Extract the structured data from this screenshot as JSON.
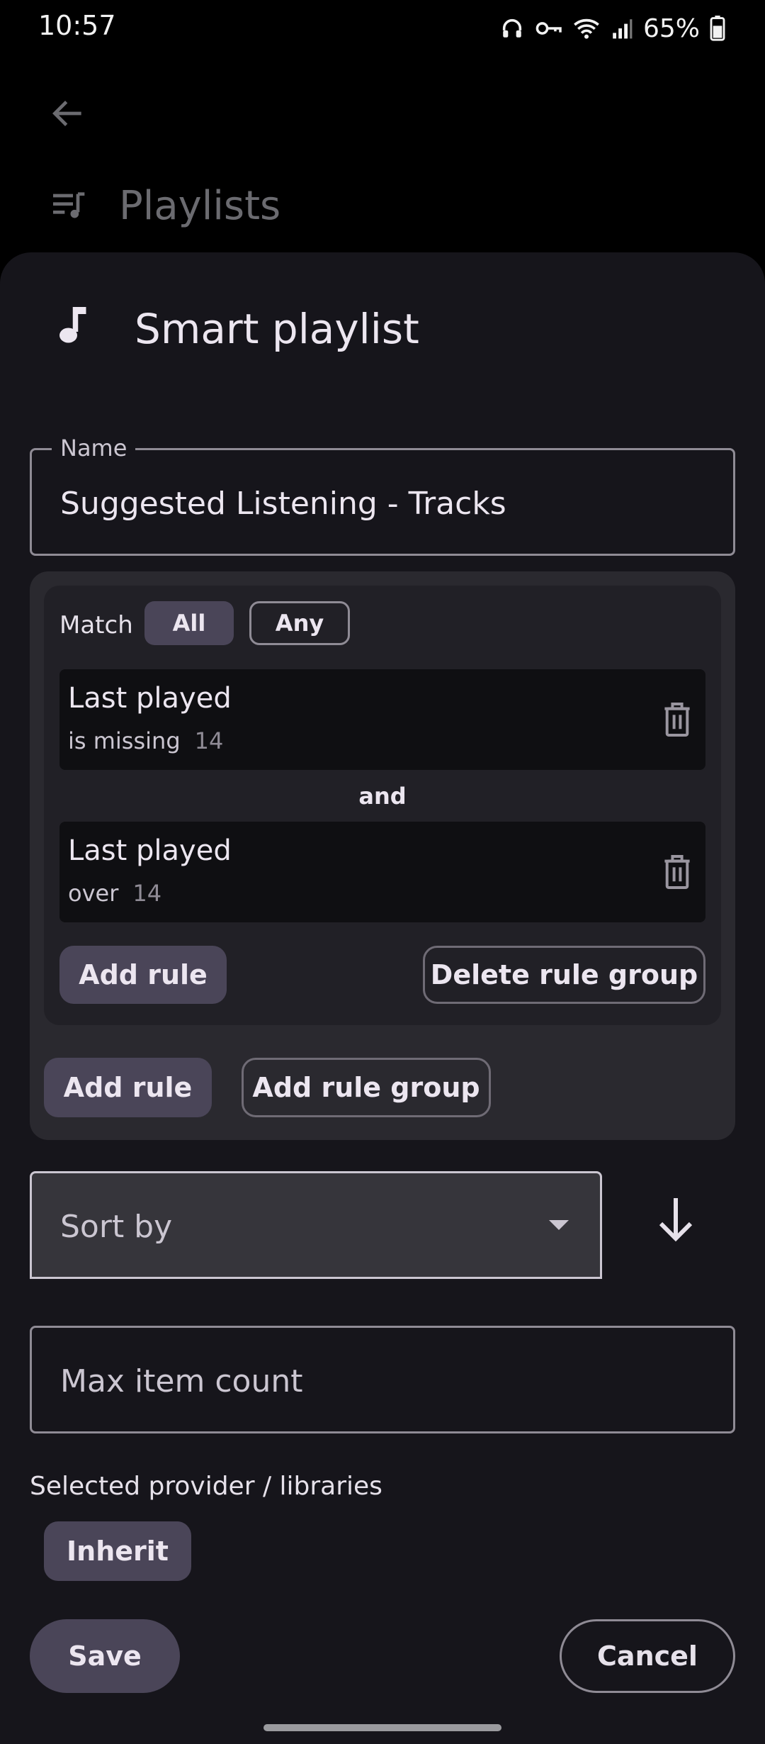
{
  "status": {
    "time": "10:57",
    "battery": "65%"
  },
  "background": {
    "title": "Playlists"
  },
  "dialog": {
    "title": "Smart playlist",
    "name_field": {
      "label": "Name",
      "value": "Suggested Listening - Tracks"
    },
    "match": {
      "label": "Match",
      "options": [
        "All",
        "Any"
      ],
      "selected": "All"
    },
    "rules": [
      {
        "field": "Last played",
        "operator": "is missing",
        "value": "14"
      },
      {
        "field": "Last played",
        "operator": "over",
        "value": "14"
      }
    ],
    "joiner": "and",
    "inner_buttons": {
      "add_rule": "Add rule",
      "delete_group": "Delete rule group"
    },
    "outer_buttons": {
      "add_rule": "Add rule",
      "add_group": "Add rule group"
    },
    "sort": {
      "placeholder": "Sort by"
    },
    "max_count": {
      "placeholder": "Max item count"
    },
    "providers": {
      "label": "Selected provider / libraries",
      "chip": "Inherit"
    },
    "actions": {
      "save": "Save",
      "cancel": "Cancel"
    }
  },
  "colors": {
    "sheet": "#16151b",
    "accent_container": "#4a4558",
    "outline": "#8f8b95"
  }
}
